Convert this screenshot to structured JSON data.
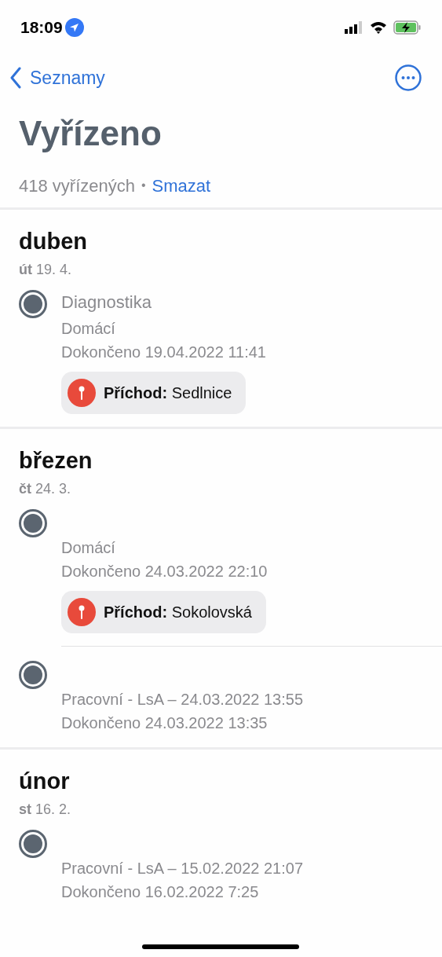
{
  "status_bar": {
    "time": "18:09"
  },
  "nav": {
    "back_label": "Seznamy"
  },
  "title": "Vyřízeno",
  "summary": {
    "count": "418 vyřízených",
    "separator": "•",
    "action": "Smazat"
  },
  "sections": [
    {
      "month": "duben",
      "day_name": "út",
      "date": "19. 4.",
      "tasks": [
        {
          "checked": true,
          "title": "Diagnostika",
          "lines": [
            "Domácí",
            "Dokončeno 19.04.2022 11:41"
          ],
          "location": {
            "label": "Příchod:",
            "place": "Sedlnice"
          }
        }
      ]
    },
    {
      "month": "březen",
      "day_name": "čt",
      "date": "24. 3.",
      "tasks": [
        {
          "checked": true,
          "lines": [
            "Domácí",
            "Dokončeno 24.03.2022 22:10"
          ],
          "location": {
            "label": "Příchod:",
            "place": "Sokolovská"
          }
        },
        {
          "checked": true,
          "lines": [
            "Pracovní - LsA – 24.03.2022 13:55",
            "Dokončeno 24.03.2022 13:35"
          ]
        }
      ]
    },
    {
      "month": "únor",
      "day_name": "st",
      "date": "16. 2.",
      "tasks": [
        {
          "checked": true,
          "lines": [
            "Pracovní - LsA – 15.02.2022 21:07",
            "Dokončeno 16.02.2022 7:25"
          ]
        }
      ]
    }
  ]
}
